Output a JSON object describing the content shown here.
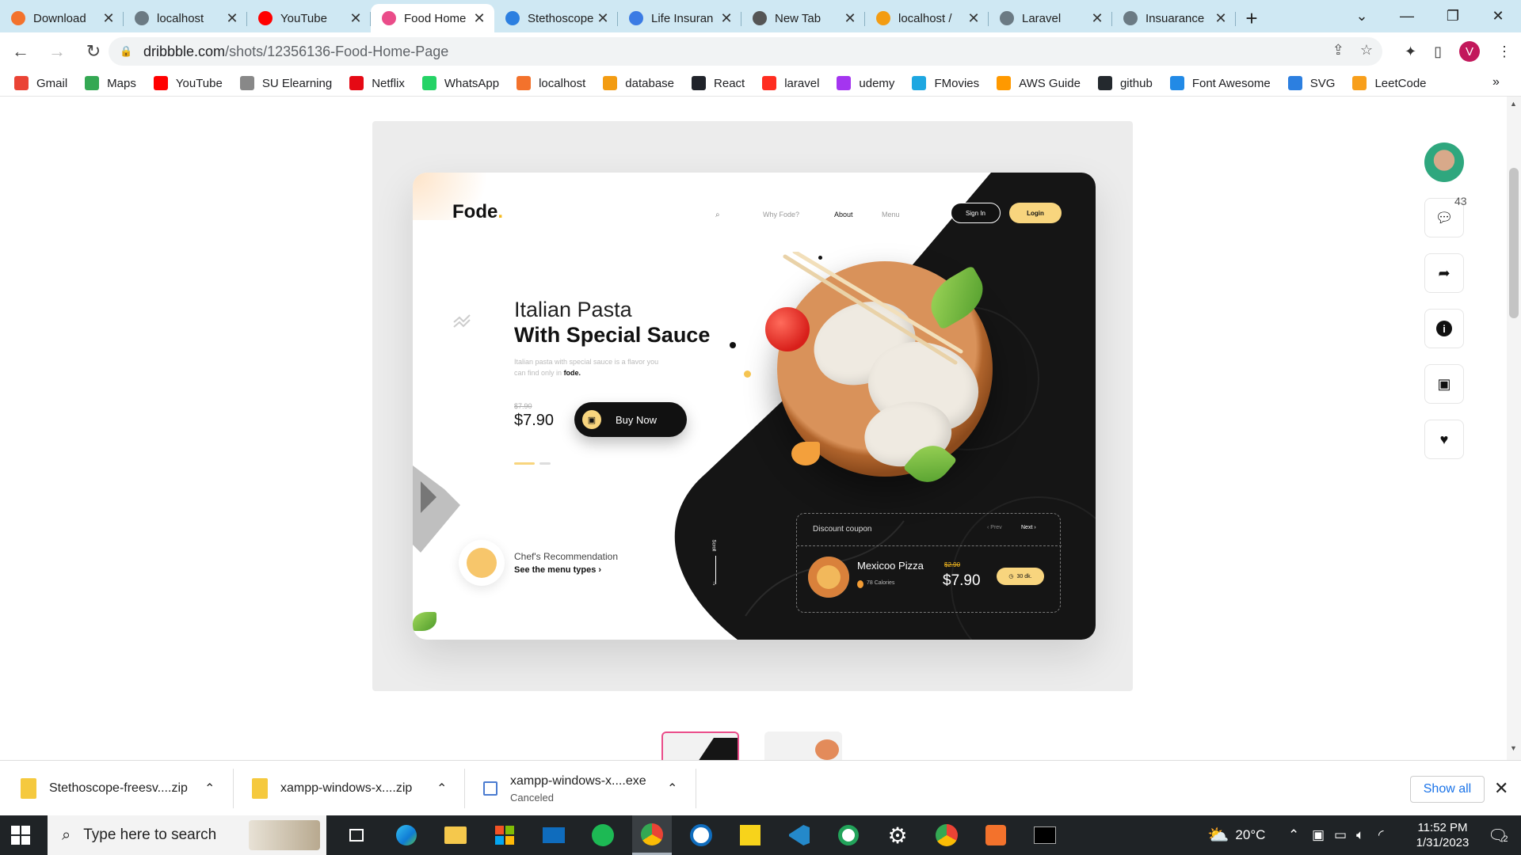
{
  "browser": {
    "tabs": [
      {
        "title": "Download",
        "favicon": "xampp-icon",
        "color": "#f3722c",
        "active": false
      },
      {
        "title": "localhost",
        "favicon": "globe-icon",
        "color": "#6b7a83",
        "active": false
      },
      {
        "title": "YouTube",
        "favicon": "youtube-icon",
        "color": "#ff0000",
        "active": false
      },
      {
        "title": "Food Home",
        "favicon": "dribbble-icon",
        "color": "#ea4c89",
        "active": true
      },
      {
        "title": "Stethoscope",
        "favicon": "edge-icon",
        "color": "#2c7fe0",
        "active": false
      },
      {
        "title": "Life Insuran",
        "favicon": "gear-icon",
        "color": "#3b7be4",
        "active": false
      },
      {
        "title": "New Tab",
        "favicon": "chrome-icon",
        "color": "#555555",
        "active": false
      },
      {
        "title": "localhost /",
        "favicon": "phpmyadmin-icon",
        "color": "#f39c12",
        "active": false
      },
      {
        "title": "Laravel",
        "favicon": "globe-icon",
        "color": "#6b7a83",
        "active": false
      },
      {
        "title": "Insuarance",
        "favicon": "globe-icon",
        "color": "#6b7a83",
        "active": false
      }
    ],
    "url_domain": "dribbble.com",
    "url_path": "/shots/12356136-Food-Home-Page",
    "profile_initial": "V",
    "bookmarks": [
      {
        "label": "Gmail",
        "icon": "gmail-icon",
        "color": "#ea4335"
      },
      {
        "label": "Maps",
        "icon": "maps-icon",
        "color": "#34a853"
      },
      {
        "label": "YouTube",
        "icon": "youtube-icon",
        "color": "#ff0000"
      },
      {
        "label": "SU Elearning",
        "icon": "elearning-icon",
        "color": "#888888"
      },
      {
        "label": "Netflix",
        "icon": "netflix-icon",
        "color": "#e50914"
      },
      {
        "label": "WhatsApp",
        "icon": "whatsapp-icon",
        "color": "#25d366"
      },
      {
        "label": "localhost",
        "icon": "xampp-icon",
        "color": "#f3722c"
      },
      {
        "label": "database",
        "icon": "phpmyadmin-icon",
        "color": "#f39c12"
      },
      {
        "label": "React",
        "icon": "react-icon",
        "color": "#20232a"
      },
      {
        "label": "laravel",
        "icon": "laravel-icon",
        "color": "#ff2d20"
      },
      {
        "label": "udemy",
        "icon": "udemy-icon",
        "color": "#a435f0"
      },
      {
        "label": "FMovies",
        "icon": "play-icon",
        "color": "#1ea7e1"
      },
      {
        "label": "AWS Guide",
        "icon": "aws-icon",
        "color": "#ff9900"
      },
      {
        "label": "github",
        "icon": "github-icon",
        "color": "#24292e"
      },
      {
        "label": "Font Awesome",
        "icon": "flag-icon",
        "color": "#228ae6"
      },
      {
        "label": "SVG",
        "icon": "edge-icon",
        "color": "#2c7fe0"
      },
      {
        "label": "LeetCode",
        "icon": "leetcode-icon",
        "color": "#f89f1b"
      }
    ]
  },
  "shot": {
    "brand": "Fode",
    "nav": [
      "Why Fode?",
      "About",
      "Menu"
    ],
    "signin_label": "Sign In",
    "login_label": "Login",
    "hero_title_1": "Italian Pasta",
    "hero_title_2": "With Special Sauce",
    "hero_desc": "Italian pasta with special sauce is a flavor you can find only in",
    "hero_desc_brand": "fode.",
    "price_old": "$7.90",
    "price_new": "$7.90",
    "buy_label": "Buy Now",
    "chef_line1": "Chef's Recommendation",
    "chef_line2": "See the menu types",
    "scroll_label": "Scroll",
    "coupon_title": "Discount coupon",
    "coupon_prev": "Prev",
    "coupon_next": "Next",
    "pizza_name": "Mexicoo Pizza",
    "pizza_calories": "78 Calories",
    "pizza_old": "$2.90",
    "pizza_price": "$7.90",
    "pizza_time": "30 dk.",
    "accent": "#f8d57e",
    "dark": "#151515"
  },
  "rail": {
    "comment_count": "43",
    "actions": [
      "comment-icon",
      "share-icon",
      "info-icon",
      "add-to-collection-icon",
      "heart-icon"
    ]
  },
  "downloads": [
    {
      "name": "Stethoscope-freesv....zip",
      "status": ""
    },
    {
      "name": "xampp-windows-x....zip",
      "status": ""
    },
    {
      "name": "xampp-windows-x....exe",
      "status": "Canceled"
    }
  ],
  "downloads_show_all": "Show all",
  "taskbar": {
    "search_placeholder": "Type here to search",
    "temperature": "20°C",
    "time": "11:52 PM",
    "date": "1/31/2023",
    "notification_count": "2"
  }
}
